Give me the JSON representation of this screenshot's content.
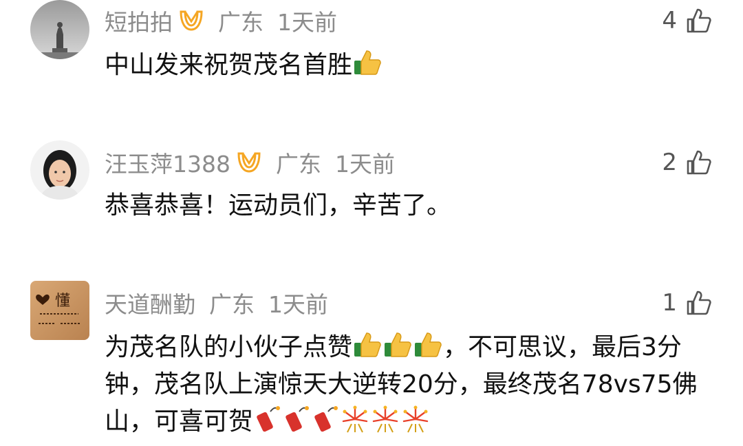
{
  "comments": [
    {
      "username": "短拍拍",
      "region": "广东",
      "time": "1天前",
      "likes": "4",
      "text": "中山发来祝贺茂名首胜",
      "avatar_icon": "statue-silhouette"
    },
    {
      "username": "汪玉萍1388",
      "region": "广东",
      "time": "1天前",
      "likes": "2",
      "text": "恭喜恭喜！运动员们，辛苦了。",
      "avatar_icon": "woman-portrait"
    },
    {
      "username": "天道酬勤",
      "region": "广东",
      "time": "1天前",
      "likes": "1",
      "text_part1": "为茂名队的小伙子点赞",
      "text_part2": "，不可思议，最后3分钟，茂名队上演惊天大逆转20分，最终茂名78vs75佛山，可喜可贺",
      "avatar_icon": "wood-carving",
      "avatar_text": "懂"
    }
  ],
  "colors": {
    "badge_orange": "#f5a623",
    "meta_gray": "#8c8c8c"
  }
}
